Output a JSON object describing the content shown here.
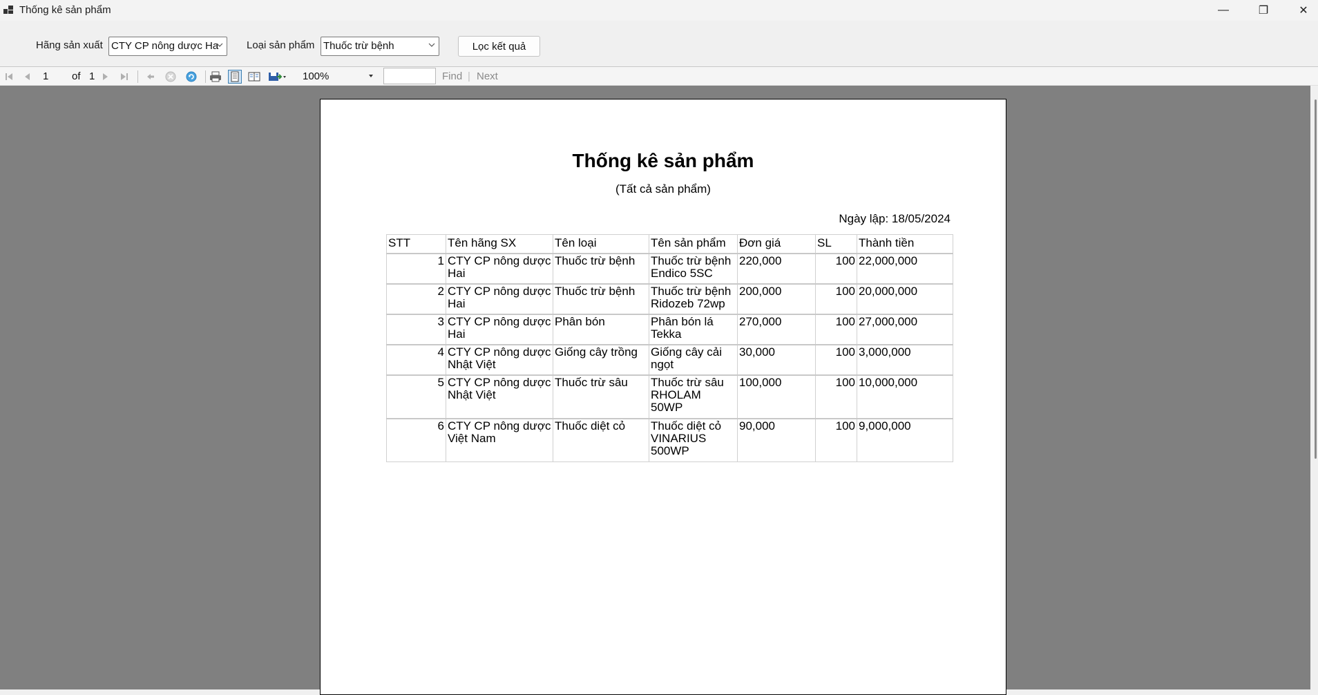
{
  "window": {
    "title": "Thống kê sản phẩm",
    "min_glyph": "—",
    "max_glyph": "❐",
    "close_glyph": "✕"
  },
  "filters": {
    "manufacturer_label": "Hãng sản xuất",
    "manufacturer_value": "CTY CP nông dược Ha",
    "category_label": "Loại sản phẩm",
    "category_value": "Thuốc trừ bệnh",
    "filter_button": "Lọc kết quả"
  },
  "toolbar": {
    "current_page": "1",
    "of_text": "of",
    "total_pages": "1",
    "zoom": "100%",
    "find_label": "Find",
    "find_sep": "|",
    "next_label": "Next",
    "icons": [
      "first-page-icon",
      "prev-page-icon",
      "next-page-icon",
      "last-page-icon",
      "back-icon",
      "stop-icon",
      "refresh-icon",
      "print-icon",
      "print-layout-icon",
      "page-setup-icon",
      "export-icon"
    ]
  },
  "report": {
    "title": "Thống kê sản phẩm",
    "subtitle": "(Tất cả sản phẩm)",
    "date_label": "Ngày lập: 18/05/2024",
    "columns": [
      "STT",
      "Tên hãng SX",
      "Tên loại",
      "Tên sản phẩm",
      "Đơn giá",
      "SL",
      "Thành tiền"
    ],
    "rows": [
      {
        "stt": "1",
        "hang": [
          "CTY CP nông dược",
          "Hai"
        ],
        "loai": [
          "Thuốc trừ bệnh"
        ],
        "sp": [
          "Thuốc trừ bệnh",
          "Endico 5SC"
        ],
        "dongia": "220,000",
        "sl": "100",
        "thanhtien": "22,000,000"
      },
      {
        "stt": "2",
        "hang": [
          "CTY CP nông dược",
          "Hai"
        ],
        "loai": [
          "Thuốc trừ bệnh"
        ],
        "sp": [
          "Thuốc trừ bệnh",
          "Ridozeb 72wp"
        ],
        "dongia": "200,000",
        "sl": "100",
        "thanhtien": "20,000,000"
      },
      {
        "stt": "3",
        "hang": [
          "CTY CP nông dược",
          "Hai"
        ],
        "loai": [
          "Phân bón"
        ],
        "sp": [
          "Phân bón lá",
          "Tekka"
        ],
        "dongia": "270,000",
        "sl": "100",
        "thanhtien": "27,000,000"
      },
      {
        "stt": "4",
        "hang": [
          "CTY CP nông dược",
          "Nhật Việt"
        ],
        "loai": [
          "Giống cây trồng"
        ],
        "sp": [
          "Giống cây cải",
          "ngọt"
        ],
        "dongia": "30,000",
        "sl": "100",
        "thanhtien": "3,000,000"
      },
      {
        "stt": "5",
        "hang": [
          "CTY CP nông dược",
          "Nhật Việt"
        ],
        "loai": [
          "Thuốc trừ sâu"
        ],
        "sp": [
          "Thuốc trừ sâu",
          "RHOLAM",
          "50WP"
        ],
        "dongia": "100,000",
        "sl": "100",
        "thanhtien": "10,000,000"
      },
      {
        "stt": "6",
        "hang": [
          "CTY CP nông dược",
          "Việt Nam"
        ],
        "loai": [
          "Thuốc diệt cỏ"
        ],
        "sp": [
          "Thuốc diệt cỏ",
          "VINARIUS",
          "500WP"
        ],
        "dongia": "90,000",
        "sl": "100",
        "thanhtien": "9,000,000"
      }
    ]
  }
}
